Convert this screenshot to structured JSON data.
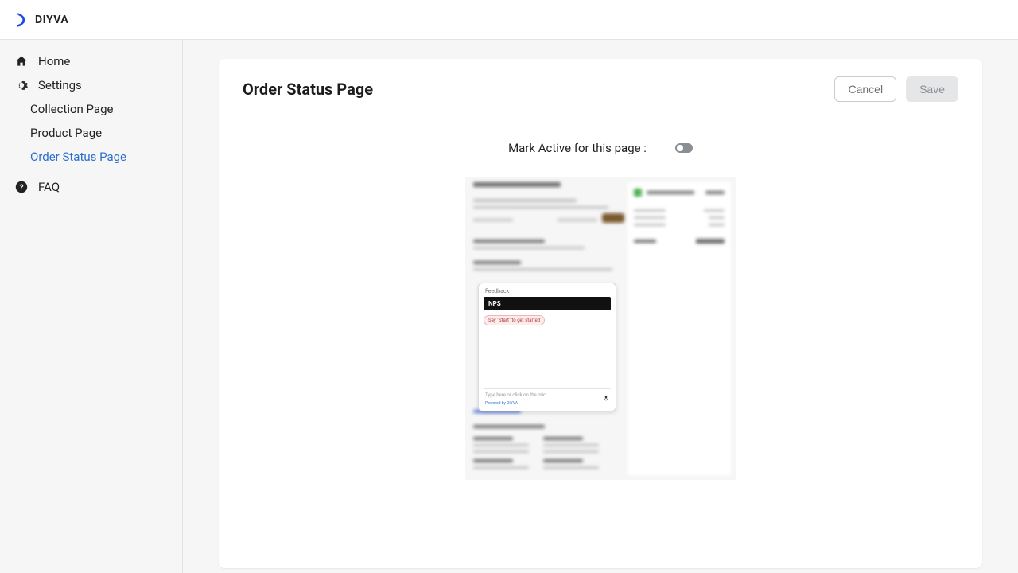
{
  "brand": {
    "name": "DIYVA"
  },
  "sidebar": {
    "home": "Home",
    "settings": "Settings",
    "items": [
      {
        "label": "Collection Page"
      },
      {
        "label": "Product Page"
      },
      {
        "label": "Order Status Page"
      }
    ],
    "faq": "FAQ"
  },
  "page": {
    "title": "Order Status Page",
    "cancel": "Cancel",
    "save": "Save",
    "toggle_label": "Mark Active for this page :"
  },
  "widget": {
    "section": "Feedback",
    "title": "NPS",
    "chip": "Say \"Start\" to get started",
    "placeholder": "Type here or click on the mic",
    "footer": "Powered by DIYVA"
  }
}
